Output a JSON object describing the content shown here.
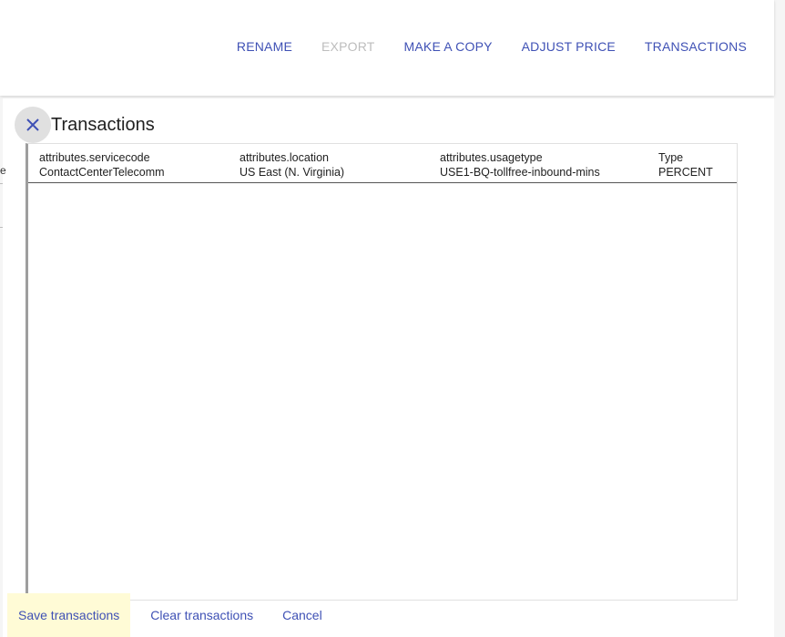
{
  "toolbar": {
    "actions": [
      {
        "label": "RENAME",
        "enabled": true
      },
      {
        "label": "EXPORT",
        "enabled": false
      },
      {
        "label": "MAKE A COPY",
        "enabled": true
      },
      {
        "label": "ADJUST PRICE",
        "enabled": true
      },
      {
        "label": "TRANSACTIONS",
        "enabled": true
      }
    ]
  },
  "background": {
    "partial_text": "e"
  },
  "dialog": {
    "close_icon": "close-icon",
    "title": "Transactions",
    "table": {
      "columns": [
        "attributes.servicecode",
        "attributes.location",
        "attributes.usagetype",
        "Type"
      ],
      "rows": [
        [
          "ContactCenterTelecomm",
          "US East (N. Virginia)",
          "USE1-BQ-tollfree-inbound-mins",
          "PERCENT"
        ]
      ]
    },
    "footer": {
      "save_label": "Save transactions",
      "clear_label": "Clear transactions",
      "cancel_label": "Cancel"
    }
  },
  "colors": {
    "accent": "#3f51b5",
    "disabled": "#bdbdbd",
    "highlight": "#fffbd6"
  }
}
